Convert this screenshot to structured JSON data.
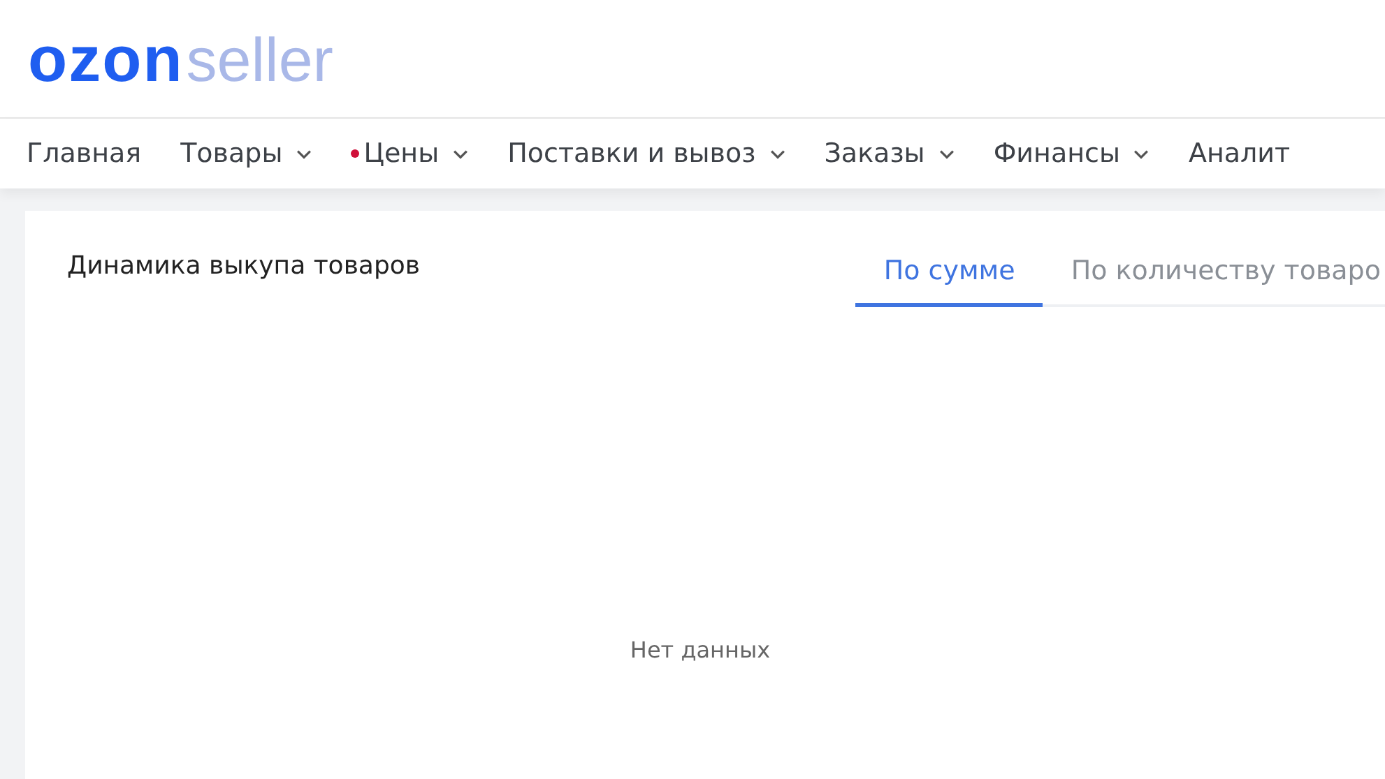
{
  "logo": {
    "brand": "ozon",
    "product": "seller"
  },
  "nav": [
    {
      "label": "Главная",
      "dropdown": false,
      "dot": false
    },
    {
      "label": "Товары",
      "dropdown": true,
      "dot": false
    },
    {
      "label": "Цены",
      "dropdown": true,
      "dot": true
    },
    {
      "label": "Поставки и вывоз",
      "dropdown": true,
      "dot": false
    },
    {
      "label": "Заказы",
      "dropdown": true,
      "dot": false
    },
    {
      "label": "Финансы",
      "dropdown": true,
      "dot": false
    },
    {
      "label": "Аналит",
      "dropdown": false,
      "dot": false
    }
  ],
  "card": {
    "title": "Динамика выкупа товаров",
    "tabs": [
      {
        "label": "По сумме",
        "selected": true
      },
      {
        "label": "По количеству товаро",
        "selected": false
      }
    ],
    "empty_message": "Нет данных"
  }
}
